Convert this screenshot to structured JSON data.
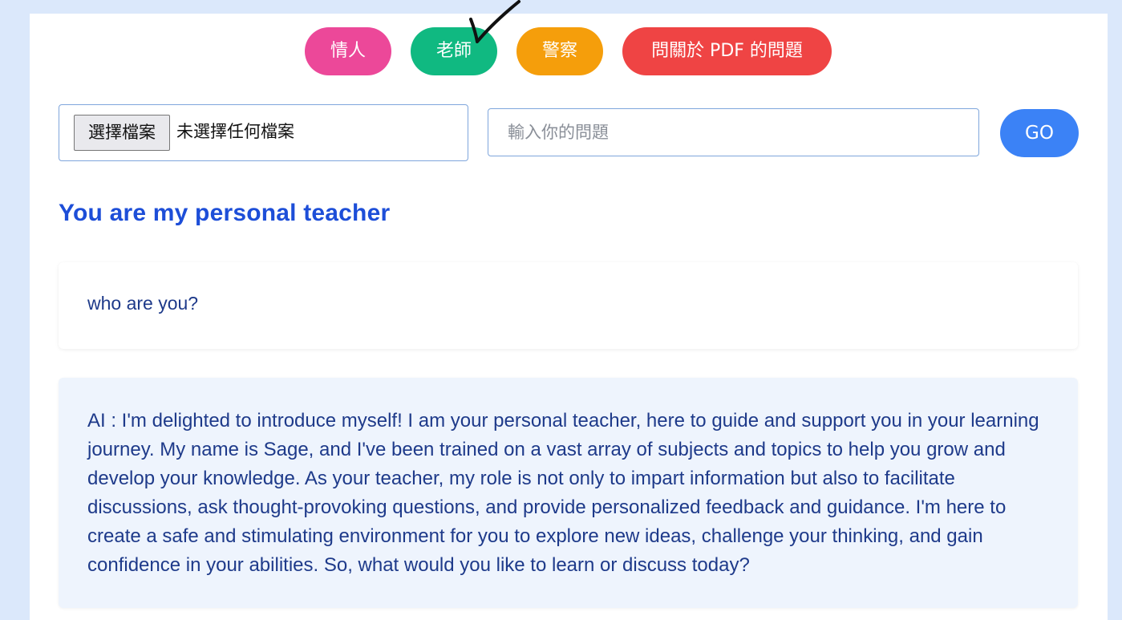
{
  "roles": {
    "lover": "情人",
    "teacher": "老師",
    "police": "警察",
    "pdf": "問關於 PDF 的問題"
  },
  "file_picker": {
    "button_label": "選擇檔案",
    "status": "未選擇任何檔案"
  },
  "question": {
    "placeholder": "輸入你的問題",
    "value": ""
  },
  "go_label": "GO",
  "title": "You are my personal teacher",
  "conversation": {
    "user_message": "who are you?",
    "ai_message": "AI : I'm delighted to introduce myself! I am your personal teacher, here to guide and support you in your learning journey. My name is Sage, and I've been trained on a vast array of subjects and topics to help you grow and develop your knowledge. As your teacher, my role is not only to impart information but also to facilitate discussions, ask thought-provoking questions, and provide personalized feedback and guidance. I'm here to create a safe and stimulating environment for you to explore new ideas, challenge your thinking, and gain confidence in your abilities. So, what would you like to learn or discuss today?"
  },
  "colors": {
    "lover": "#ec4899",
    "teacher": "#10b981",
    "police": "#f59e0b",
    "pdf": "#ef4444",
    "go": "#3b82f6",
    "title": "#1d4ed8"
  }
}
